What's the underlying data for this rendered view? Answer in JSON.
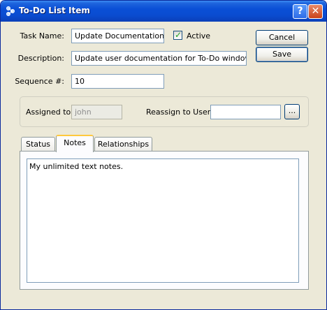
{
  "window": {
    "title": "To-Do List Item",
    "help_glyph": "?",
    "close_glyph": "✕"
  },
  "form": {
    "task_name_label": "Task Name:",
    "task_name_value": "Update Documentation",
    "active_label": "Active",
    "active_checked": true,
    "description_label": "Description:",
    "description_value": "Update user documentation for To-Do window",
    "sequence_label": "Sequence #:",
    "sequence_value": "10"
  },
  "buttons": {
    "cancel": "Cancel",
    "save": "Save",
    "ellipsis": "..."
  },
  "assignment": {
    "assigned_label": "Assigned to:",
    "assigned_value": "john",
    "reassign_label": "Reassign to User:",
    "reassign_value": ""
  },
  "tabs": [
    {
      "label": "Status",
      "active": false
    },
    {
      "label": "Notes",
      "active": true
    },
    {
      "label": "Relationships",
      "active": false
    }
  ],
  "notes": {
    "text": "My unlimited text notes."
  },
  "colors": {
    "titlebar": "#0A4FD6",
    "face": "#ECE9D8",
    "tab_highlight": "#FFC83C"
  },
  "icons": {
    "title": "app-network-icon",
    "check": "checkmark-icon"
  }
}
